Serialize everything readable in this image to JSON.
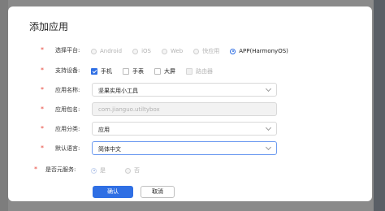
{
  "dialog": {
    "title": "添加应用"
  },
  "platform": {
    "label": "选择平台:",
    "options": [
      "Android",
      "iOS",
      "Web",
      "快应用",
      "APP(HarmonyOS)"
    ],
    "selected": "APP(HarmonyOS)"
  },
  "devices": {
    "label": "支持设备:",
    "options": [
      "手机",
      "手表",
      "大屏",
      "路由器"
    ],
    "checked": [
      "手机"
    ]
  },
  "app_name": {
    "label": "应用名称:",
    "value": "坚果实用小工具"
  },
  "package_name": {
    "label": "应用包名:",
    "value": "com.jianguo.utiltybox"
  },
  "category": {
    "label": "应用分类:",
    "value": "应用"
  },
  "language": {
    "label": "默认语言:",
    "value": "简体中文"
  },
  "yuanservice": {
    "label": "是否元服务:",
    "options": [
      "是",
      "否"
    ],
    "selected": "是"
  },
  "buttons": {
    "confirm": "确认",
    "cancel": "取消"
  },
  "colors": {
    "accent": "#2f6fe4",
    "required": "#e8483c"
  }
}
